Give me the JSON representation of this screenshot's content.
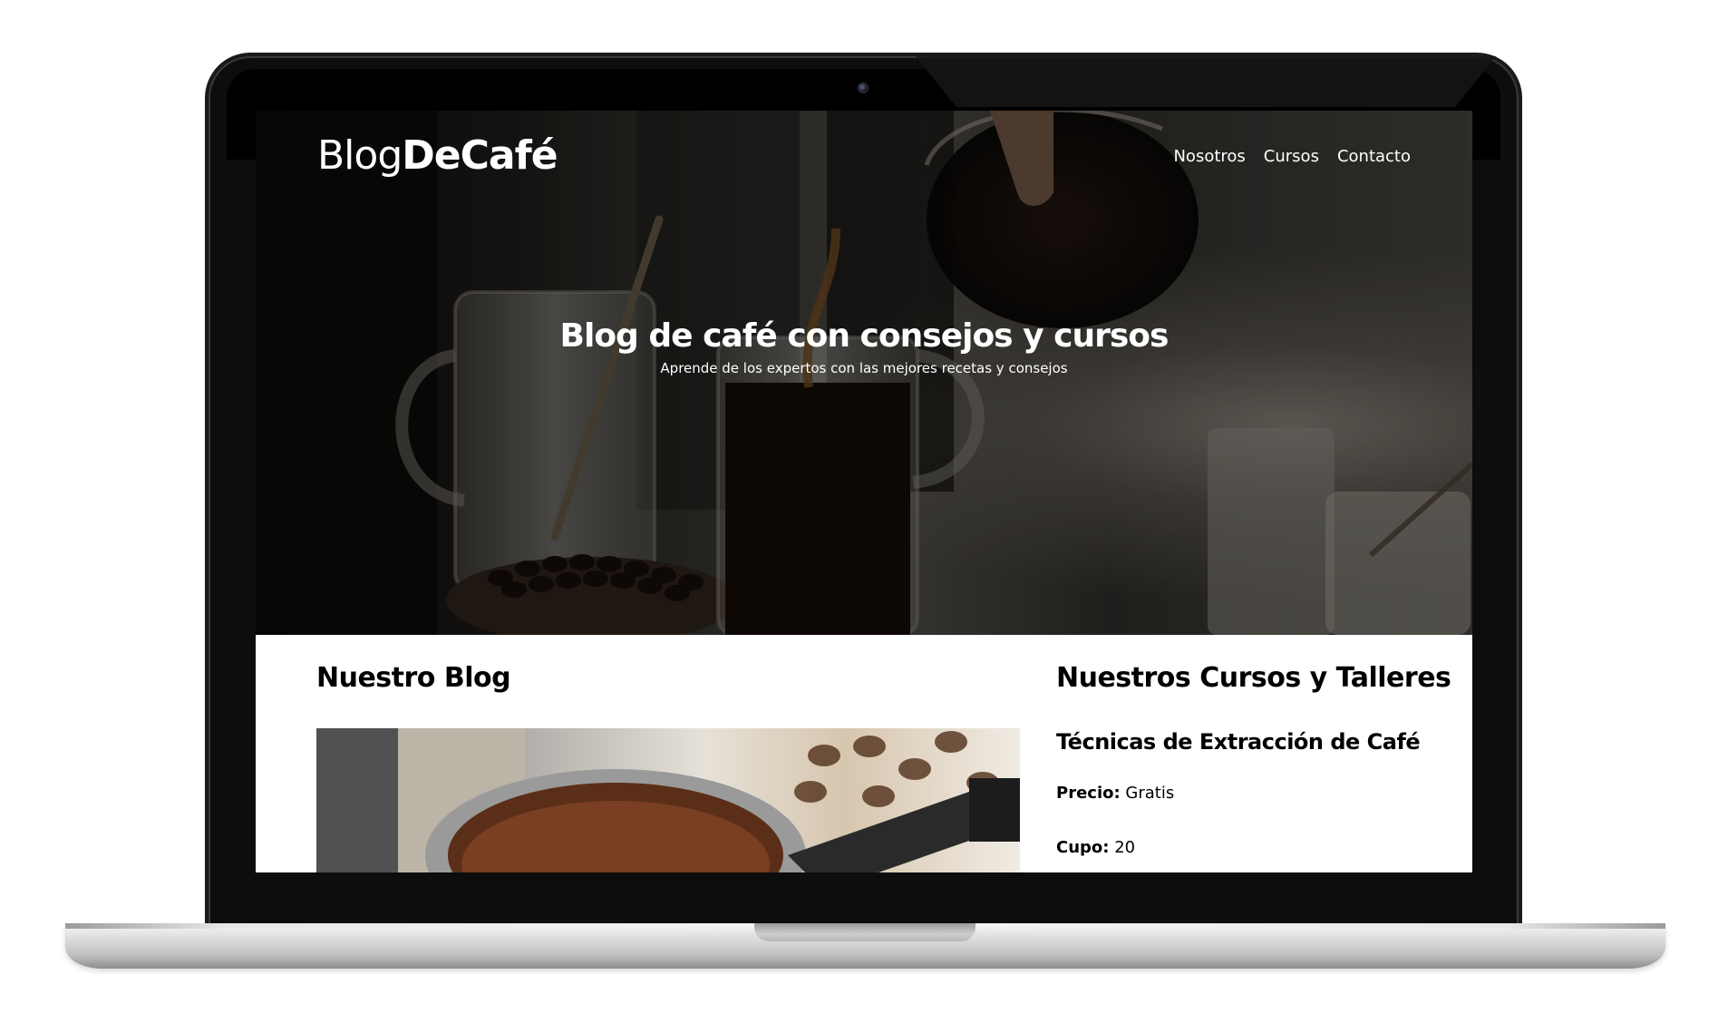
{
  "site": {
    "logo_light": "Blog",
    "logo_bold": "DeCafé"
  },
  "nav": {
    "items": [
      {
        "label": "Nosotros"
      },
      {
        "label": "Cursos"
      },
      {
        "label": "Contacto"
      }
    ]
  },
  "hero": {
    "title": "Blog de café con consejos y cursos",
    "subtitle": "Aprende de los expertos con las mejores recetas y consejos"
  },
  "blog": {
    "title": "Nuestro Blog"
  },
  "courses": {
    "title": "Nuestros Cursos y Talleres",
    "items": [
      {
        "name": "Técnicas de Extracción de Café",
        "price_label": "Precio:",
        "price_value": "Gratis",
        "seats_label": "Cupo:",
        "seats_value": "20"
      }
    ]
  },
  "colors": {
    "laptop_frame": "#0d0d0d",
    "text_on_hero": "#ffffff",
    "body_text": "#000000",
    "page_background": "#ffffff"
  }
}
